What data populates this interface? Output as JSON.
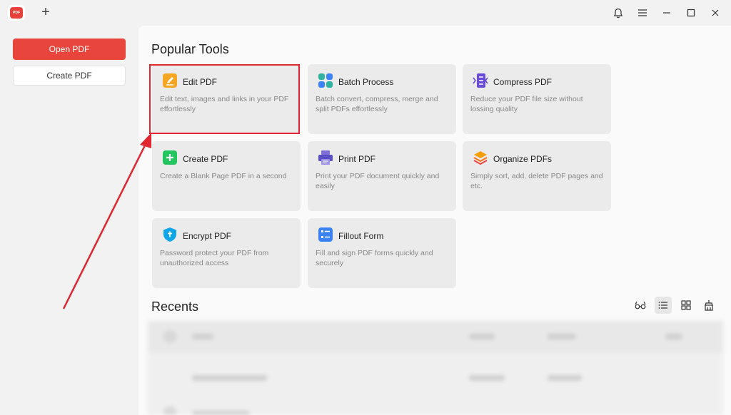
{
  "titlebar": {
    "logo_text": "PDF",
    "new_tab_label": "+"
  },
  "sidebar": {
    "open_label": "Open PDF",
    "create_label": "Create PDF"
  },
  "popular": {
    "title": "Popular Tools",
    "tools": [
      {
        "title": "Edit PDF",
        "desc": "Edit text, images and links in your PDF effortlessly",
        "icon": "edit-icon"
      },
      {
        "title": "Batch Process",
        "desc": "Batch convert, compress, merge and split PDFs effortlessly",
        "icon": "batch-icon"
      },
      {
        "title": "Compress PDF",
        "desc": "Reduce your PDF file size without lossing quality",
        "icon": "compress-icon"
      },
      {
        "title": "Create PDF",
        "desc": "Create a Blank Page PDF in a second",
        "icon": "create-pdf-icon"
      },
      {
        "title": "Print PDF",
        "desc": "Print your PDF document quickly and easily",
        "icon": "printer-icon"
      },
      {
        "title": "Organize PDFs",
        "desc": "Simply sort, add, delete PDF pages and etc.",
        "icon": "layers-icon"
      },
      {
        "title": "Encrypt PDF",
        "desc": "Password protect your PDF from unauthorized access",
        "icon": "shield-icon"
      },
      {
        "title": "Fillout Form",
        "desc": "Fill and sign PDF forms quickly and securely",
        "icon": "form-icon"
      }
    ]
  },
  "recents": {
    "title": "Recents",
    "view_icons": [
      "glasses-icon",
      "list-view-icon",
      "grid-view-icon",
      "clear-icon"
    ]
  },
  "colors": {
    "accent": "#e8453c",
    "highlight": "#e0262f"
  }
}
